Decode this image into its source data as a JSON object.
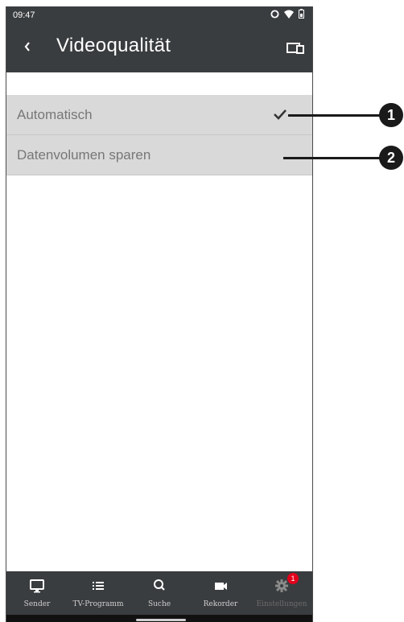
{
  "status_bar": {
    "time": "09:47"
  },
  "app_bar": {
    "title": "Videoqualität"
  },
  "options": [
    {
      "label": "Automatisch",
      "selected": true
    },
    {
      "label": "Datenvolumen sparen",
      "selected": false
    }
  ],
  "callouts": [
    "1",
    "2"
  ],
  "bottom_nav": [
    {
      "label": "Sender",
      "icon": "tv-icon"
    },
    {
      "label": "TV-Programm",
      "icon": "list-icon"
    },
    {
      "label": "Suche",
      "icon": "search-icon"
    },
    {
      "label": "Rekorder",
      "icon": "video-camera-icon"
    },
    {
      "label": "Einstellungen",
      "icon": "gear-icon",
      "badge": "1"
    }
  ],
  "colors": {
    "bar": "#3a3d3f",
    "row": "#d9d9d9",
    "badge": "#e3001b"
  }
}
